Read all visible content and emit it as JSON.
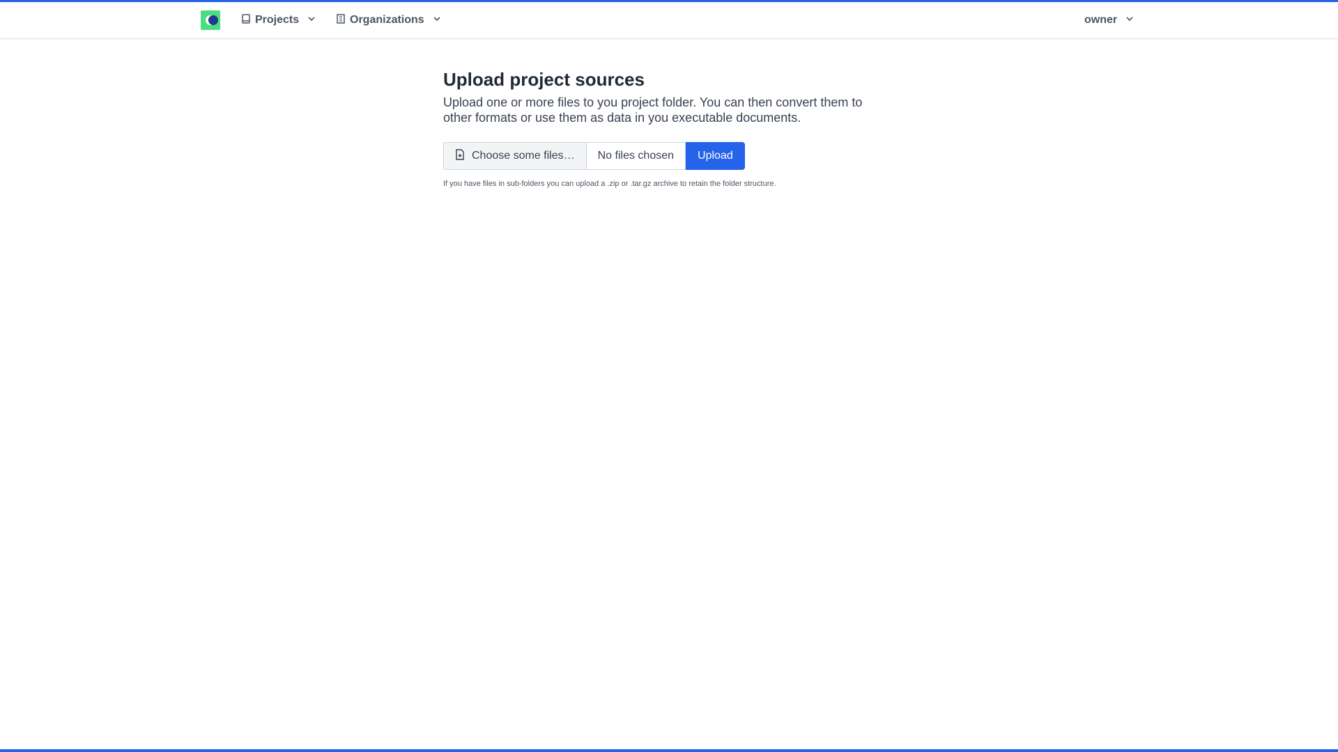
{
  "nav": {
    "projects_label": "Projects",
    "organizations_label": "Organizations",
    "user_label": "owner"
  },
  "main": {
    "title": "Upload project sources",
    "description": "Upload one or more files to you project folder. You can then convert them to other formats or use them as data in you executable documents.",
    "choose_label": "Choose some files…",
    "file_status": "No files chosen",
    "upload_label": "Upload",
    "help_text": "If you have files in sub-folders you can upload a .zip or .tar.gz archive to retain the folder structure."
  },
  "colors": {
    "accent": "#2563eb",
    "logo_green": "#4ade80",
    "logo_dark": "#1e3a8a"
  },
  "icons": {
    "projects": "book-icon",
    "organizations": "building-icon",
    "choose": "file-plus-icon",
    "dropdown": "chevron-down-icon"
  }
}
